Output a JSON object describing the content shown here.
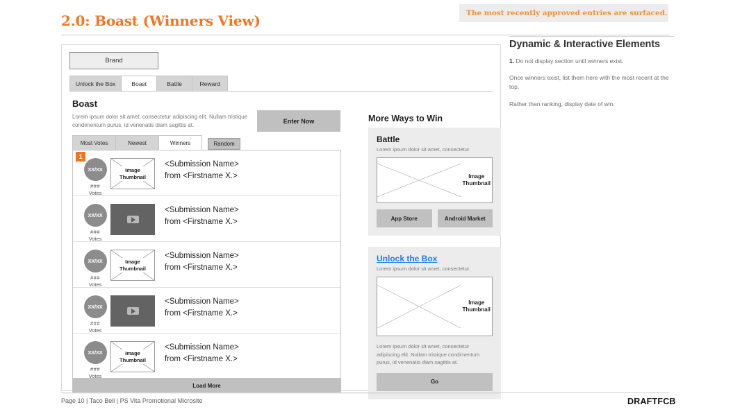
{
  "deck": {
    "title": "2.0: Boast (Winners View)",
    "callout": "The most recently approved entries are surfaced.",
    "footer": "Page 10 | Taco Bell | PS Vita Promotional Microsite",
    "logo": "DRAFTFCB"
  },
  "notes": {
    "title": "Dynamic & Interactive Elements",
    "items": [
      {
        "num": "1.",
        "text": " Do not display section until winners exist."
      },
      {
        "num": "",
        "text": "Once winners exist, list them here with the most recent at the top."
      },
      {
        "num": "",
        "text": "Rather than ranking, display date of win."
      }
    ]
  },
  "wireframe": {
    "brand": "Brand",
    "tabs": [
      {
        "label": "Unlock the Box",
        "active": false
      },
      {
        "label": "Boast",
        "active": true
      },
      {
        "label": "Battle",
        "active": false
      },
      {
        "label": "Reward",
        "active": false
      }
    ],
    "section": {
      "title": "Boast",
      "description": "Lorem ipsum dolor sit amet, consectetur adipiscing elit. Nullam tristique condimentum purus, id venenatis diam sagittis at.",
      "cta": "Enter Now"
    },
    "subtabs": [
      {
        "label": "Most Votes",
        "active": false
      },
      {
        "label": "Newest",
        "active": false
      },
      {
        "label": "Winners",
        "active": true
      }
    ],
    "random_button": "Random",
    "annotation_badge": "1",
    "list": {
      "rows": [
        {
          "votes_circle": "XX/XX",
          "votes_num": "###",
          "votes_label": "Votes",
          "thumb_type": "image",
          "thumb_label_1": "Image",
          "thumb_label_2": "Thumbnail",
          "name": "<Submission Name>",
          "author": "from <Firstname X.>"
        },
        {
          "votes_circle": "XX/XX",
          "votes_num": "###",
          "votes_label": "Votes",
          "thumb_type": "video",
          "thumb_label_1": "",
          "thumb_label_2": "",
          "name": "<Submission Name>",
          "author": "from <Firstname X.>"
        },
        {
          "votes_circle": "XX/XX",
          "votes_num": "###",
          "votes_label": "Votes",
          "thumb_type": "image",
          "thumb_label_1": "Image",
          "thumb_label_2": "Thumbnail",
          "name": "<Submission Name>",
          "author": "from <Firstname X.>"
        },
        {
          "votes_circle": "XX/XX",
          "votes_num": "###",
          "votes_label": "Votes",
          "thumb_type": "video",
          "thumb_label_1": "",
          "thumb_label_2": "",
          "name": "<Submission Name>",
          "author": "from <Firstname X.>"
        },
        {
          "votes_circle": "XX/XX",
          "votes_num": "###",
          "votes_label": "Votes",
          "thumb_type": "image",
          "thumb_label_1": "Image",
          "thumb_label_2": "Thumbnail",
          "name": "<Submission Name>",
          "author": "from <Firstname X.>"
        }
      ],
      "load_more": "Load More"
    },
    "more_ways": {
      "title": "More Ways to Win",
      "battle": {
        "heading": "Battle",
        "sub": "Lorem ipsum dolor sit amet, consectetur.",
        "thumb_label_1": "Image",
        "thumb_label_2": "Thumbnail",
        "button_1": "App Store",
        "button_2": "Android Market"
      },
      "unlock": {
        "heading": "Unlock the Box",
        "sub": "Lorem ipsum dolor sit amet, consectetur.",
        "thumb_label_1": "Image",
        "thumb_label_2": "Thumbnail",
        "body": "Lorem ipsum dolor sit amet, consectetur adipiscing elit. Nullam tristique condimentum purus, id venenatis diam sagittis at.",
        "button": "Go"
      }
    }
  },
  "colors": {
    "accent_orange": "#f4741f",
    "link_blue": "#1a7df5",
    "button_gray": "#c0c0c0",
    "card_gray": "#ececec"
  }
}
